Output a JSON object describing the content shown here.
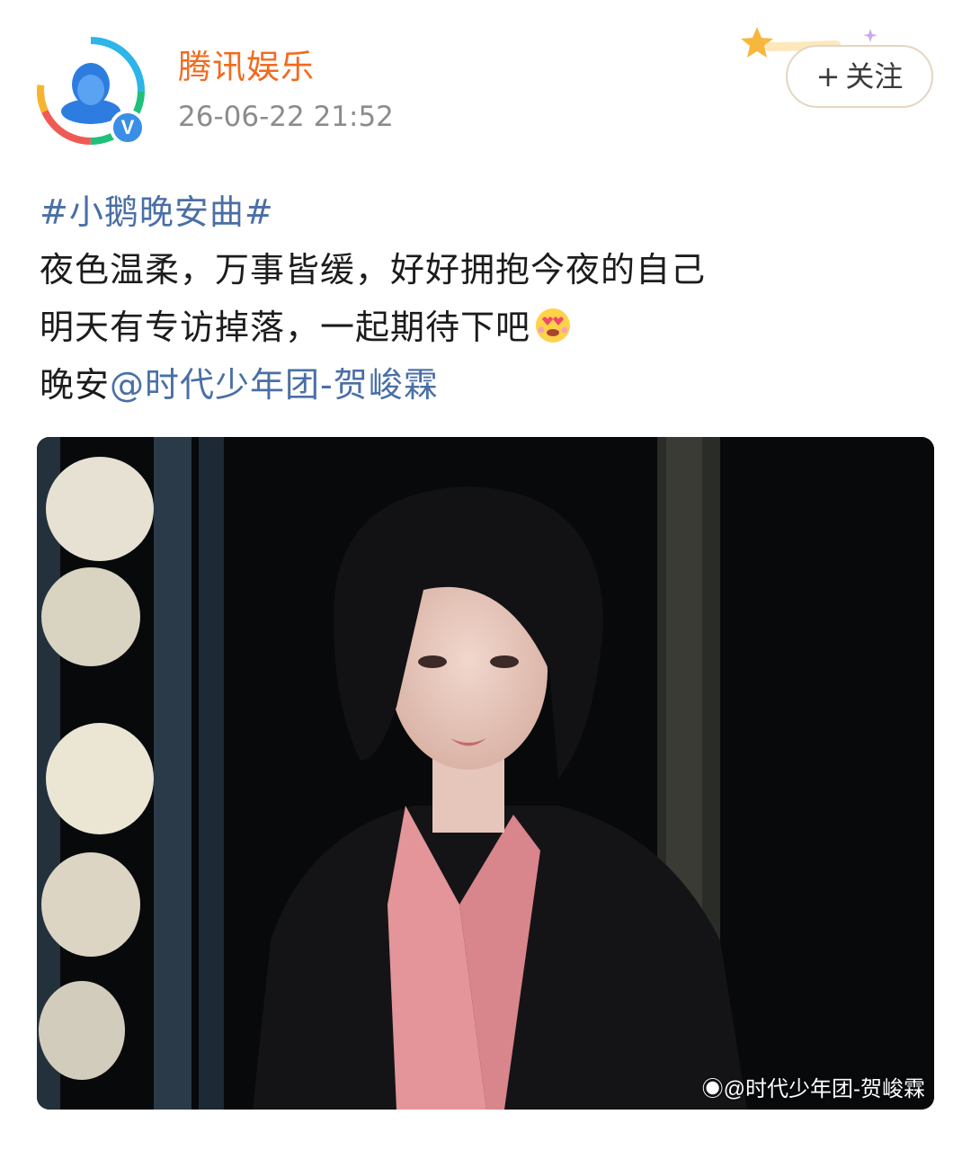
{
  "header": {
    "account_name": "腾讯娱乐",
    "post_time": "26-06-22 21:52",
    "verified_mark": "V",
    "follow_label": "关注",
    "follow_plus": "+"
  },
  "post": {
    "hashtag": "#小鹅晚安曲#",
    "line1": "夜色温柔，万事皆缓，好好拥抱今夜的自己",
    "line2": "明天有专访掉落，一起期待下吧",
    "line2_emoji": "heart-eyes-face-icon",
    "line3_prefix": "晚安",
    "mention": "@时代少年团-贺峻霖"
  },
  "photo": {
    "watermark": "@时代少年团-贺峻霖",
    "watermark_icon": "weibo-logo-icon"
  },
  "colors": {
    "account_name": "#f26b1f",
    "link": "#4a6fa5",
    "time": "#8c8c8c",
    "verified": "#3a8ee6"
  }
}
